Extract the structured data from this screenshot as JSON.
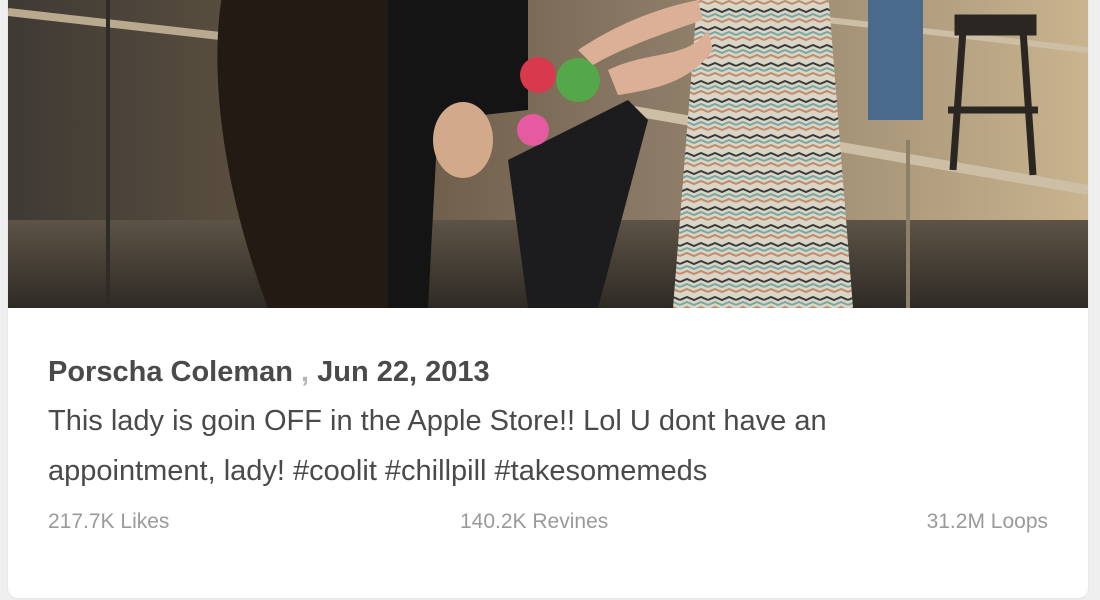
{
  "post": {
    "author": "Porscha Coleman",
    "separator": ",",
    "date": "Jun 22, 2013",
    "description": "This lady is goin OFF in the Apple Store!! Lol U dont have an appointment, lady! #coolit #chillpill #takesomemeds"
  },
  "stats": {
    "likes": "217.7K Likes",
    "revines": "140.2K Revines",
    "loops": "31.2M Loops"
  }
}
